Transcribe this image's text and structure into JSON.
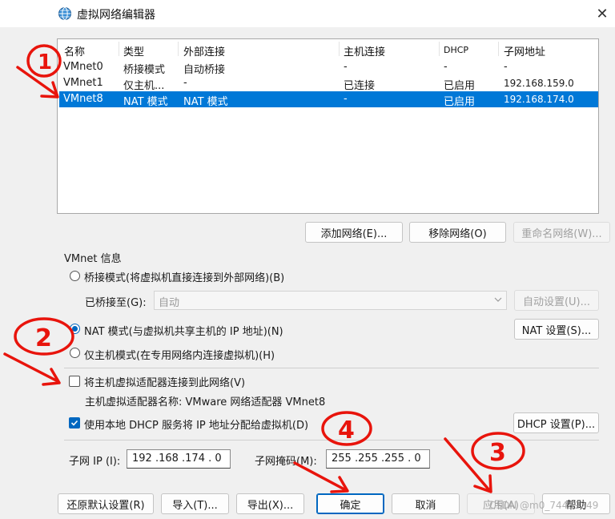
{
  "window": {
    "title": "虚拟网络编辑器",
    "close": "✕"
  },
  "table": {
    "headers": [
      "名称",
      "类型",
      "外部连接",
      "主机连接",
      "DHCP",
      "子网地址"
    ],
    "rows": [
      [
        "VMnet0",
        "桥接模式",
        "自动桥接",
        "-",
        "-",
        "-"
      ],
      [
        "VMnet1",
        "仅主机...",
        "-",
        "已连接",
        "已启用",
        "192.168.159.0"
      ],
      [
        "VMnet8",
        "NAT 模式",
        "NAT 模式",
        "-",
        "已启用",
        "192.168.174.0"
      ]
    ],
    "selected_row": 2
  },
  "net_buttons": {
    "add": "添加网络(E)...",
    "remove": "移除网络(O)",
    "rename": "重命名网络(W)..."
  },
  "vmnet_info": {
    "group_title": "VMnet 信息",
    "bridge_radio": "桥接模式(将虚拟机直接连接到外部网络)(B)",
    "bridged_to_label": "已桥接至(G):",
    "bridged_to_value": "自动",
    "auto_settings": "自动设置(U)...",
    "nat_radio": "NAT 模式(与虚拟机共享主机的 IP 地址)(N)",
    "nat_settings": "NAT 设置(S)...",
    "hostonly_radio": "仅主机模式(在专用网络内连接虚拟机)(H)",
    "connect_adapter_check": "将主机虚拟适配器连接到此网络(V)",
    "adapter_name": "主机虚拟适配器名称: VMware 网络适配器 VMnet8",
    "dhcp_check": "使用本地 DHCP 服务将 IP 地址分配给虚拟机(D)",
    "dhcp_settings": "DHCP 设置(P)...",
    "subnet_ip_label": "子网 IP (I):",
    "subnet_ip": "192 .168 .174 .  0",
    "subnet_mask_label": "子网掩码(M):",
    "subnet_mask": "255 .255 .255 .  0"
  },
  "bottom_buttons": {
    "restore": "还原默认设置(R)",
    "import": "导入(T)...",
    "export": "导出(X)...",
    "ok": "确定",
    "cancel": "取消",
    "apply": "应用(A)",
    "help": "帮助"
  },
  "annotations": {
    "n1": "1",
    "n2": "2",
    "n3": "3",
    "n4": "4",
    "color": "#e8140c"
  },
  "watermark": "CSDN @m0_74459249",
  "colors": {
    "selection": "#0078d7",
    "accent": "#0067c0"
  }
}
